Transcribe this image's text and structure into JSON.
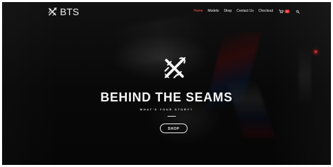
{
  "brand": {
    "text": "BTS",
    "icon": "needle-thread-badge-icon"
  },
  "nav": {
    "items": [
      {
        "label": "Home",
        "active": true
      },
      {
        "label": "Models",
        "active": false
      },
      {
        "label": "Shop",
        "active": false
      },
      {
        "label": "Contact Us",
        "active": false
      },
      {
        "label": "Checkout",
        "active": false
      }
    ],
    "cart_count": "0",
    "cart_icon": "cart-icon",
    "search_icon": "search-icon",
    "active_color": "#ff4d4d"
  },
  "hero": {
    "logo_icon": "needle-thread-badge-icon",
    "title": "BEHIND THE SEAMS",
    "subtitle": "WHAT'S YOUR STORY?",
    "button_label": "SHOP"
  },
  "colors": {
    "accent": "#ff4d4d",
    "text": "#f7f7f7",
    "background": "#080808"
  }
}
